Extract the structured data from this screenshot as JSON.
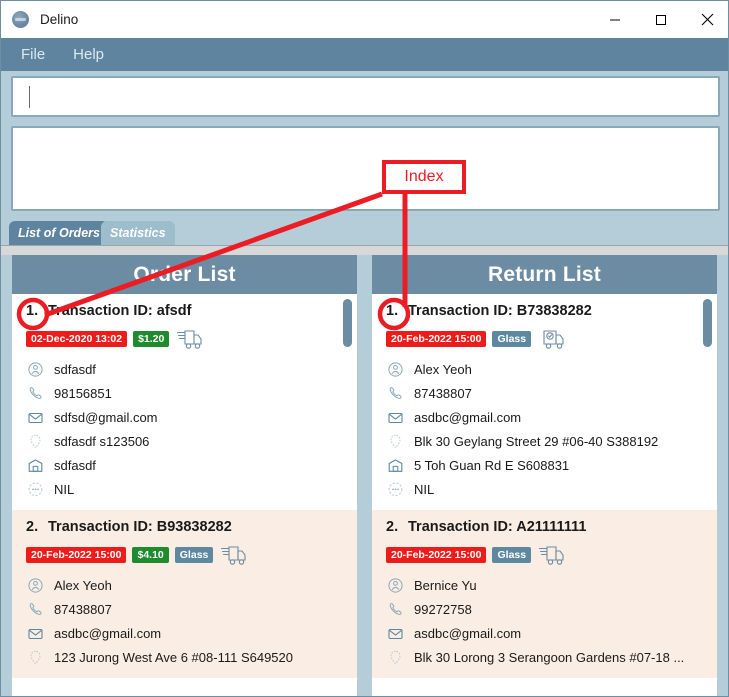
{
  "window": {
    "title": "Delino",
    "logo_icon": "app-logo-icon",
    "minimize_icon": "minimize-icon",
    "maximize_icon": "maximize-icon",
    "close_icon": "close-icon"
  },
  "menu": {
    "items": [
      {
        "label": "File"
      },
      {
        "label": "Help"
      }
    ]
  },
  "command_input": {
    "value": "",
    "placeholder": ""
  },
  "result_box": {
    "value": ""
  },
  "tabs": [
    {
      "label": "List of Orders",
      "active": true
    },
    {
      "label": "Statistics",
      "active": false
    }
  ],
  "annotation": {
    "label": "Index",
    "color": "#ec1c24"
  },
  "order_panel": {
    "title": "Order List",
    "cards": [
      {
        "index": "1.",
        "transaction_label": "Transaction ID: afsdf",
        "date_badge": "02-Dec-2020 13:02",
        "price_badge": "$1.20",
        "tag_badge": null,
        "truck_icon": "delivery-truck-icon",
        "rows": [
          {
            "icon": "person-icon",
            "text": "sdfasdf"
          },
          {
            "icon": "phone-icon",
            "text": "98156851"
          },
          {
            "icon": "email-icon",
            "text": "sdfsd@gmail.com"
          },
          {
            "icon": "location-icon",
            "text": "sdfasdf s123506"
          },
          {
            "icon": "warehouse-icon",
            "text": "sdfasdf"
          },
          {
            "icon": "comment-icon",
            "text": "NIL"
          }
        ]
      },
      {
        "index": "2.",
        "transaction_label": "Transaction ID: B93838282",
        "date_badge": "20-Feb-2022 15:00",
        "price_badge": "$4.10",
        "tag_badge": "Glass",
        "truck_icon": "delivery-truck-icon",
        "rows": [
          {
            "icon": "person-icon",
            "text": "Alex Yeoh"
          },
          {
            "icon": "phone-icon",
            "text": "87438807"
          },
          {
            "icon": "email-icon",
            "text": "asdbc@gmail.com"
          },
          {
            "icon": "location-icon",
            "text": "123 Jurong West Ave 6 #08-111 S649520"
          }
        ]
      }
    ]
  },
  "return_panel": {
    "title": "Return List",
    "cards": [
      {
        "index": "1.",
        "transaction_label": "Transaction ID: B73838282",
        "date_badge": "20-Feb-2022 15:00",
        "price_badge": null,
        "tag_badge": "Glass",
        "truck_icon": "return-truck-icon",
        "rows": [
          {
            "icon": "person-icon",
            "text": "Alex Yeoh"
          },
          {
            "icon": "phone-icon",
            "text": "87438807"
          },
          {
            "icon": "email-icon",
            "text": "asdbc@gmail.com"
          },
          {
            "icon": "location-icon",
            "text": "Blk 30 Geylang Street 29 #06-40 S388192"
          },
          {
            "icon": "warehouse-icon",
            "text": "5 Toh Guan Rd E S608831"
          },
          {
            "icon": "comment-icon",
            "text": "NIL"
          }
        ]
      },
      {
        "index": "2.",
        "transaction_label": "Transaction ID: A21111111",
        "date_badge": "20-Feb-2022 15:00",
        "price_badge": null,
        "tag_badge": "Glass",
        "truck_icon": "delivery-truck-icon",
        "rows": [
          {
            "icon": "person-icon",
            "text": "Bernice Yu"
          },
          {
            "icon": "phone-icon",
            "text": "99272758"
          },
          {
            "icon": "email-icon",
            "text": "asdbc@gmail.com"
          },
          {
            "icon": "location-icon",
            "text": "Blk 30 Lorong 3 Serangoon Gardens #07-18 ..."
          }
        ]
      }
    ]
  },
  "colors": {
    "accent": "#5f84a0",
    "panel_header": "#6b8ca3",
    "window_bg": "#b5cdd8",
    "date_badge": "#ee1b1b",
    "price_badge": "#1e8c2e",
    "tag_badge": "#5d88a0",
    "card_alt_bg": "#faeee4",
    "annotation": "#ec1c24"
  }
}
